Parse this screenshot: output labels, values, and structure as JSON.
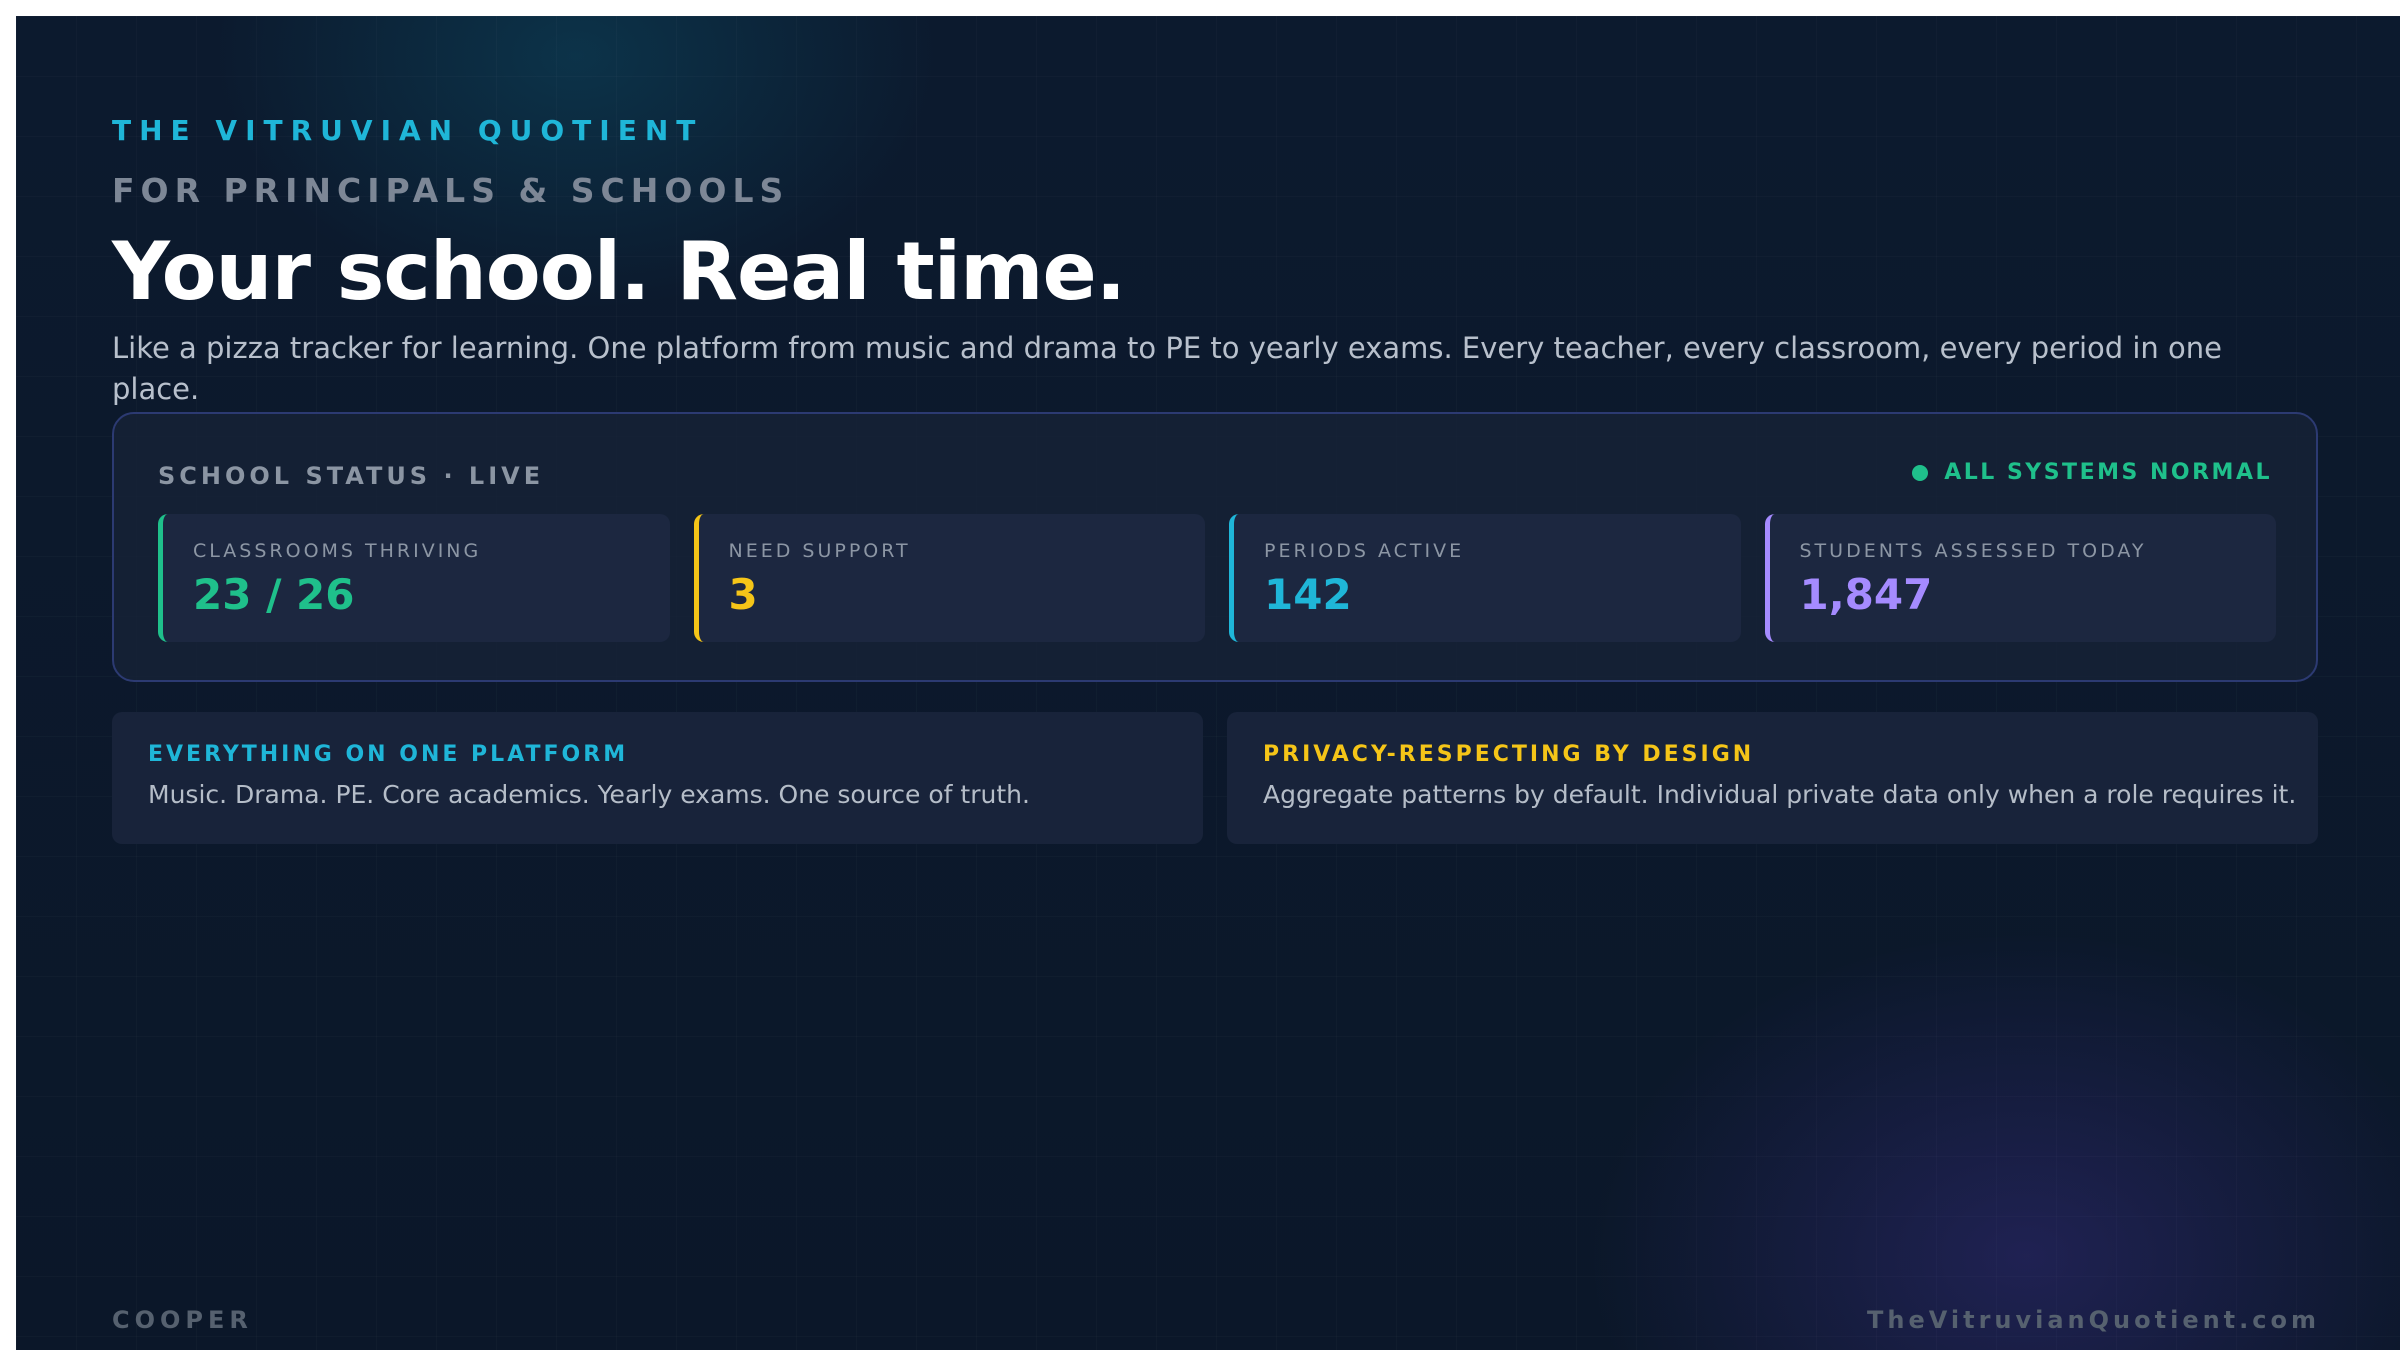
{
  "header": {
    "eyebrow": "THE VITRUVIAN QUOTIENT",
    "audience": "FOR PRINCIPALS & SCHOOLS",
    "headline": "Your school. Real time.",
    "subhead": "Like a pizza tracker for learning. One platform from music and drama to PE to yearly exams. Every teacher, every classroom, every period in one place."
  },
  "status": {
    "title": "SCHOOL STATUS · LIVE",
    "indicator": "ALL SYSTEMS NORMAL",
    "indicator_color": "#1fc08b",
    "metrics": [
      {
        "label": "CLASSROOMS THRIVING",
        "value": "23 / 26",
        "color": "#1fc08b"
      },
      {
        "label": "NEED SUPPORT",
        "value": "3",
        "color": "#f5c518"
      },
      {
        "label": "PERIODS ACTIVE",
        "value": "142",
        "color": "#1fb6d8"
      },
      {
        "label": "STUDENTS ASSESSED TODAY",
        "value": "1,847",
        "color": "#a58bff"
      }
    ]
  },
  "features": [
    {
      "title": "EVERYTHING ON ONE PLATFORM",
      "text": "Music. Drama. PE. Core academics. Yearly exams. One source of truth.",
      "color": "#1fb6d8"
    },
    {
      "title": "PRIVACY-RESPECTING BY DESIGN",
      "text": "Aggregate patterns by default. Individual private data only when a role requires it.",
      "color": "#f5c518"
    }
  ],
  "footer": {
    "left": "COOPER",
    "right": "TheVitruvianQuotient.com"
  }
}
